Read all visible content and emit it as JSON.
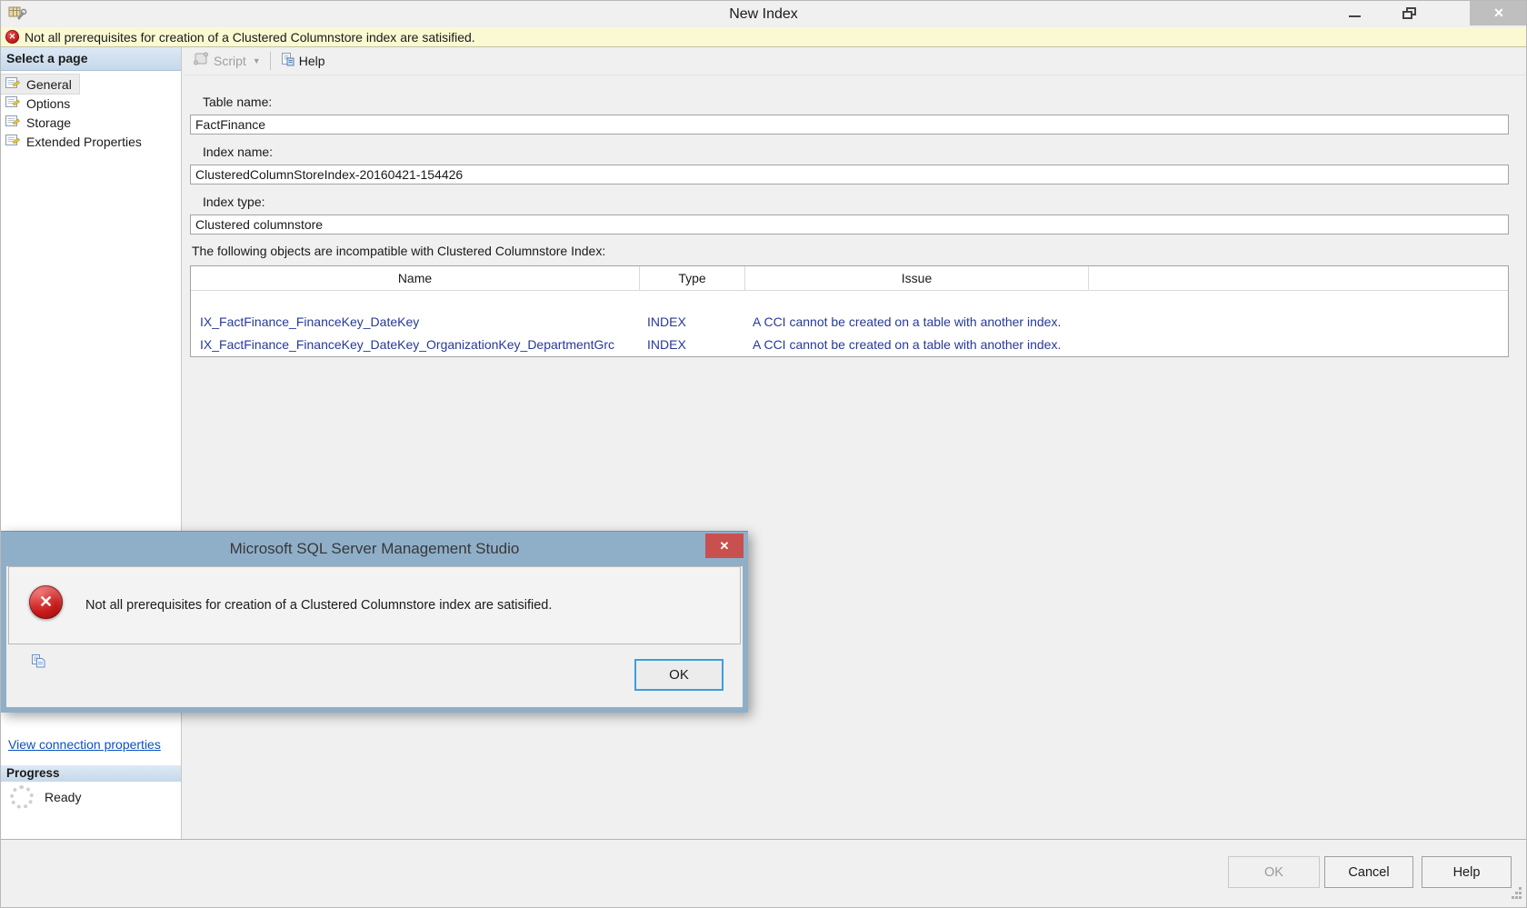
{
  "window": {
    "title": "New Index",
    "close_glyph": "✕"
  },
  "warning_bar": {
    "text": "Not all prerequisites for creation of a Clustered Columnstore index are satisified.",
    "icon_glyph": "✕"
  },
  "sidebar": {
    "header": "Select a page",
    "items": [
      {
        "label": "General"
      },
      {
        "label": "Options"
      },
      {
        "label": "Storage"
      },
      {
        "label": "Extended Properties"
      }
    ],
    "connection_link": "View connection properties",
    "progress_header": "Progress",
    "progress_status": "Ready"
  },
  "toolbar": {
    "script_label": "Script",
    "script_caret": "▼",
    "help_label": "Help"
  },
  "form": {
    "table_name_label": "Table name:",
    "table_name_value": "FactFinance",
    "index_name_label": "Index name:",
    "index_name_value": "ClusteredColumnStoreIndex-20160421-154426",
    "index_type_label": "Index type:",
    "index_type_value": "Clustered columnstore",
    "incompatible_label": "The following objects are incompatible with Clustered Columnstore Index:"
  },
  "objects_table": {
    "columns": [
      "Name",
      "Type",
      "Issue"
    ],
    "rows": [
      {
        "name": "IX_FactFinance_FinanceKey_DateKey",
        "type": "INDEX",
        "issue": "A CCI cannot be created on a table with another index."
      },
      {
        "name": "IX_FactFinance_FinanceKey_DateKey_OrganizationKey_DepartmentGrc",
        "type": "INDEX",
        "issue": "A CCI cannot be created on a table with another index."
      }
    ]
  },
  "dialog": {
    "title": "Microsoft SQL Server Management Studio",
    "message": "Not all prerequisites for creation of a Clustered Columnstore index are satisified.",
    "error_glyph": "✕",
    "close_glyph": "✕",
    "ok_label": "OK"
  },
  "footer": {
    "ok_label": "OK",
    "cancel_label": "Cancel",
    "help_label": "Help"
  },
  "colors": {
    "dialog_titlebar": "#8fafc9",
    "dialog_close_red": "#c8504f",
    "warning_bg": "#faf9d2",
    "link_blue": "#0b50c8",
    "table_row_blue": "#26399b",
    "focus_border_blue": "#3e9ddf",
    "sidebar_header_top": "#dde9f5",
    "sidebar_header_bottom": "#c6d8ea"
  }
}
